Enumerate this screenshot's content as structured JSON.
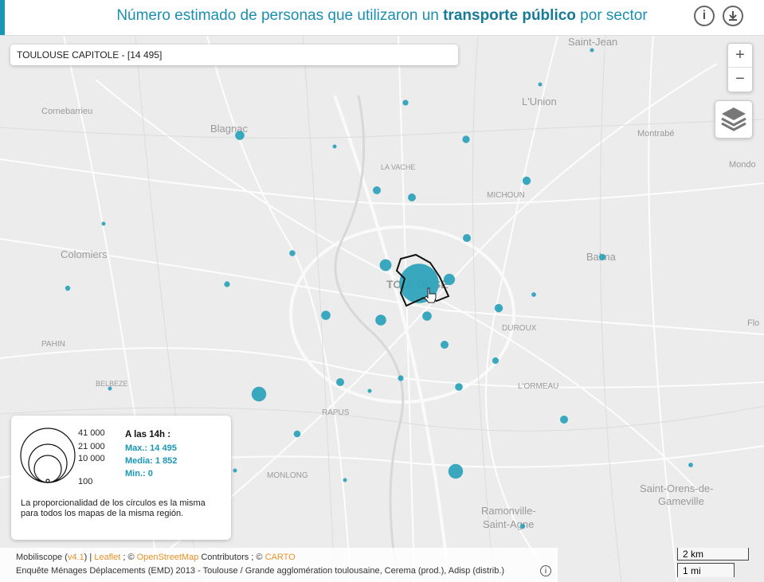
{
  "header": {
    "title_pre": "Número estimado de personas que utilizaron un ",
    "title_bold": "transporte público",
    "title_post": " por sector",
    "info_icon": "info-icon",
    "download_icon": "download-icon"
  },
  "selected_sector": "TOULOUSE CAPITOLE - [14 495]",
  "zoom": {
    "in_label": "+",
    "out_label": "−"
  },
  "layers_icon": "layers-icon",
  "place_labels": [
    "Saint-Jean",
    "L'Union",
    "Cornebarrieu",
    "Blagnac",
    "Montrabé",
    "LA VACHE",
    "MICHOUN",
    "Colomiers",
    "Balma",
    "TOULOUSE",
    "DUROUX",
    "PAHIN",
    "BELBEZE",
    "L'ORMEAU",
    "RAPUS",
    "MONLONG",
    "Saint-Orens-de-",
    "Gameville",
    "Ramonville-",
    "Saint-Agne",
    "Mondo",
    "Flo"
  ],
  "legend": {
    "values": [
      "41 000",
      "21 000",
      "10 000",
      "100"
    ],
    "time_label": "A las 14h :",
    "max": "Max.: 14 495",
    "mean": "Media: 1 852",
    "min": "Min.: 0",
    "note": "La proporcionalidad de los círculos es la misma para todos los mapas de la misma región."
  },
  "attribution": {
    "mobiliscope": "Mobiliscope (",
    "version": "v4.1",
    "sep1": ") | ",
    "leaflet": "Leaflet",
    "sep2": " ; © ",
    "osm": "OpenStreetMap",
    "contrib": " Contributors ; © ",
    "carto": "CARTO",
    "source": "Enquête Ménages Déplacements (EMD) 2013 - Toulouse / Grande agglomération toulousaine, Cerema (prod.), Adisp (distrib.)"
  },
  "scale": {
    "km": "2 km",
    "mi": "1 mi"
  },
  "colors": {
    "accent": "#1a96b5",
    "circle": "#2fa3bb"
  },
  "circles": [
    {
      "lon": 743,
      "lat": 63,
      "v": 50
    },
    {
      "lon": 678,
      "lat": 106,
      "v": 60
    },
    {
      "lon": 509,
      "lat": 129,
      "v": 300
    },
    {
      "lon": 301,
      "lat": 170,
      "v": 800
    },
    {
      "lon": 420,
      "lat": 184,
      "v": 100
    },
    {
      "lon": 585,
      "lat": 175,
      "v": 500
    },
    {
      "lon": 661,
      "lat": 227,
      "v": 650
    },
    {
      "lon": 473,
      "lat": 239,
      "v": 600
    },
    {
      "lon": 517,
      "lat": 248,
      "v": 600
    },
    {
      "lon": 130,
      "lat": 281,
      "v": 150
    },
    {
      "lon": 586,
      "lat": 299,
      "v": 600
    },
    {
      "lon": 367,
      "lat": 318,
      "v": 350
    },
    {
      "lon": 756,
      "lat": 323,
      "v": 400
    },
    {
      "lon": 484,
      "lat": 333,
      "v": 1300
    },
    {
      "lon": 526,
      "lat": 356,
      "v": 14495
    },
    {
      "lon": 564,
      "lat": 351,
      "v": 1200
    },
    {
      "lon": 85,
      "lat": 362,
      "v": 250
    },
    {
      "lon": 285,
      "lat": 357,
      "v": 300
    },
    {
      "lon": 670,
      "lat": 370,
      "v": 200
    },
    {
      "lon": 626,
      "lat": 387,
      "v": 650
    },
    {
      "lon": 409,
      "lat": 396,
      "v": 800
    },
    {
      "lon": 478,
      "lat": 402,
      "v": 1100
    },
    {
      "lon": 536,
      "lat": 397,
      "v": 800
    },
    {
      "lon": 558,
      "lat": 433,
      "v": 600
    },
    {
      "lon": 622,
      "lat": 453,
      "v": 400
    },
    {
      "lon": 503,
      "lat": 475,
      "v": 300
    },
    {
      "lon": 427,
      "lat": 480,
      "v": 600
    },
    {
      "lon": 576,
      "lat": 486,
      "v": 550
    },
    {
      "lon": 464,
      "lat": 491,
      "v": 100
    },
    {
      "lon": 138,
      "lat": 488,
      "v": 80
    },
    {
      "lon": 325,
      "lat": 495,
      "v": 2000
    },
    {
      "lon": 708,
      "lat": 527,
      "v": 600
    },
    {
      "lon": 373,
      "lat": 545,
      "v": 450
    },
    {
      "lon": 867,
      "lat": 584,
      "v": 200
    },
    {
      "lon": 572,
      "lat": 592,
      "v": 2000
    },
    {
      "lon": 295,
      "lat": 591,
      "v": 50
    },
    {
      "lon": 433,
      "lat": 603,
      "v": 100
    },
    {
      "lon": 656,
      "lat": 661,
      "v": 250
    }
  ]
}
